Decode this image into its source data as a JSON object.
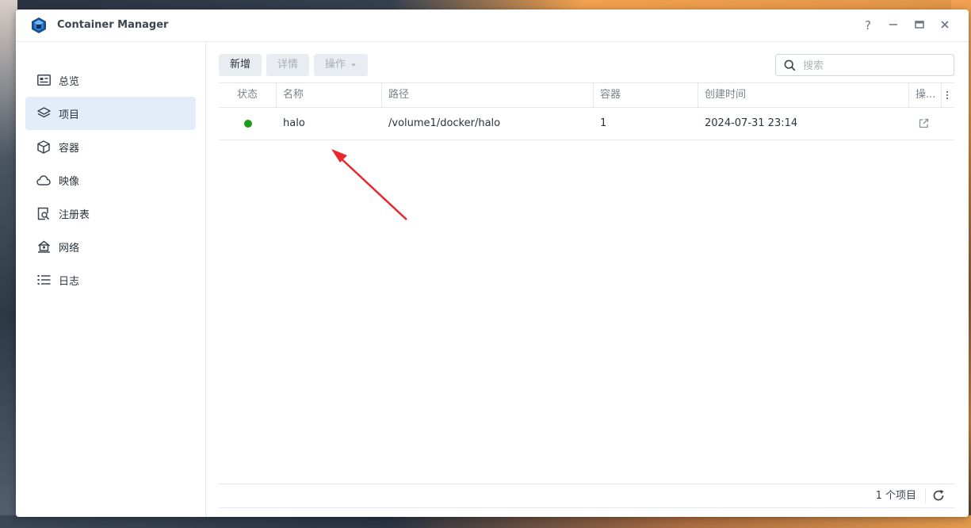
{
  "app": {
    "title": "Container Manager"
  },
  "window_controls": {
    "help": "?",
    "minimize": "—",
    "maximize": "▭",
    "close": "✕"
  },
  "sidebar": {
    "items": [
      {
        "label": "总览",
        "icon": "overview-icon"
      },
      {
        "label": "项目",
        "icon": "layers-icon",
        "active": true
      },
      {
        "label": "容器",
        "icon": "cube-icon"
      },
      {
        "label": "映像",
        "icon": "cloud-icon"
      },
      {
        "label": "注册表",
        "icon": "registry-icon"
      },
      {
        "label": "网络",
        "icon": "network-icon"
      },
      {
        "label": "日志",
        "icon": "list-icon"
      }
    ]
  },
  "toolbar": {
    "new_label": "新增",
    "details_label": "详情",
    "action_label": "操作"
  },
  "search": {
    "placeholder": "搜索"
  },
  "table": {
    "columns": [
      "状态",
      "名称",
      "路径",
      "容器",
      "创建时间",
      "操..."
    ],
    "rows": [
      {
        "status_color": "#1a9c1a",
        "name": "halo",
        "path": "/volume1/docker/halo",
        "containers": "1",
        "created": "2024-07-31 23:14"
      }
    ]
  },
  "footer": {
    "count_label": "1 个项目"
  },
  "colors": {
    "accent": "#1d6fd1",
    "annotation_arrow": "#e8262b",
    "running": "#1a9c1a"
  }
}
